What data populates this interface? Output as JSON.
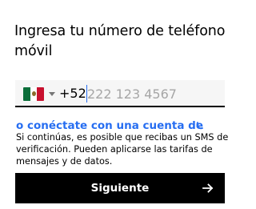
{
  "heading": "Ingresa tu número de teléfono móvil",
  "phone": {
    "country_code": "+52",
    "value": "",
    "placeholder": "222 123 4567",
    "flag": "mexico-flag-icon"
  },
  "alt_link": "o conéctate con una cuenta de",
  "disclaimer": "Si continúas, es posible que recibas un SMS de verificación. Pueden aplicarse las tarifas de mensajes y de datos.",
  "next_button": {
    "label": "Siguiente",
    "icon": "arrow-right-icon"
  },
  "colors": {
    "accent": "#276ef1",
    "button_bg": "#000000",
    "input_bg": "#f6f6f6"
  }
}
